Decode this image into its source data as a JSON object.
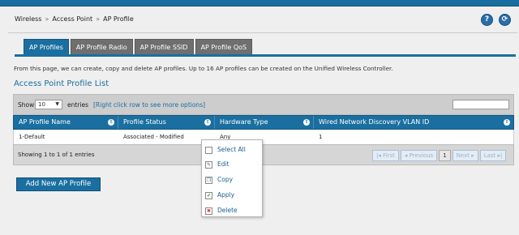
{
  "breadcrumb": [
    "Wireless",
    "Access Point",
    "AP Profile"
  ],
  "breadcrumb_sep": "»",
  "header_buttons": {
    "help": "?",
    "logout": "⟳"
  },
  "tabs": [
    "AP Profiles",
    "AP Profile Radio",
    "AP Profile SSID",
    "AP Profile QoS"
  ],
  "description": "From this page, we can create, copy and delete AP profiles. Up to 16 AP profiles can be created on the Unified Wireless Controller.",
  "section_title": "Access Point Profile List",
  "list_controls": {
    "show_label": "Show",
    "page_size": "10",
    "entries_label": "entries",
    "hint": "[Right click row to see more options]"
  },
  "table": {
    "columns": [
      "AP Profile Name",
      "Profile Status",
      "Hardware Type",
      "Wired Network Discovery VLAN ID"
    ],
    "rows": [
      [
        "1-Default",
        "Associated - Modified",
        "Any",
        "1"
      ]
    ]
  },
  "footer": {
    "showing": "Showing 1 to 1 of 1 entries",
    "pager": [
      "First",
      "Previous",
      "1",
      "Next",
      "Last"
    ]
  },
  "add_button": "Add New AP Profile",
  "context_menu": [
    "Select All",
    "Edit",
    "Copy",
    "Apply",
    "Delete"
  ],
  "colors": {
    "accent": "#1a6fa0",
    "background": "#efefef"
  }
}
